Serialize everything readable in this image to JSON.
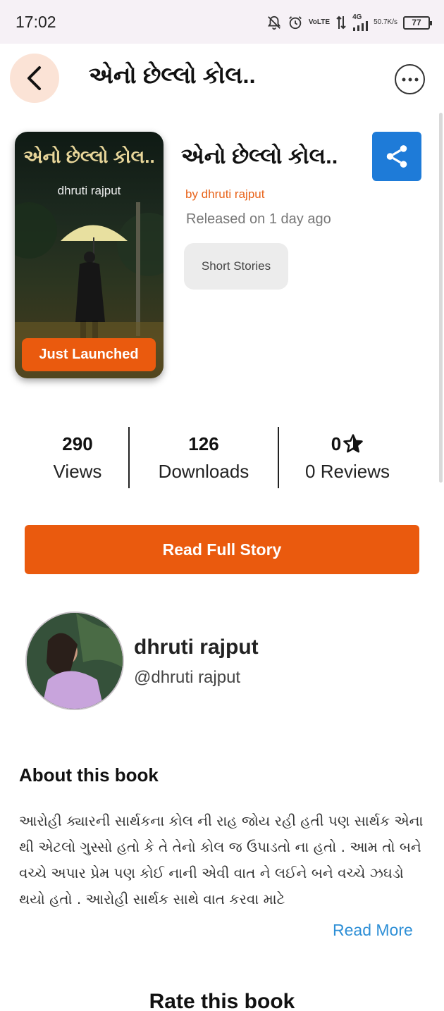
{
  "status_bar": {
    "time": "17:02",
    "volte_top": "Vo",
    "volte_bottom": "LTE",
    "network": "4G",
    "speed_top": "50.7",
    "speed_bottom": "K/s",
    "battery": "77"
  },
  "header": {
    "title": "એનો છેલ્લો કોલ.."
  },
  "book": {
    "cover_title": "એનો છેલ્લો કોલ..",
    "cover_author": "dhruti rajput",
    "badge": "Just Launched",
    "title": "એનો છેલ્લો કોલ..",
    "author_line": "by dhruti rajput",
    "released": "Released on 1 day ago",
    "genre": "Short Stories"
  },
  "stats": {
    "views_count": "290",
    "views_label": "Views",
    "downloads_count": "126",
    "downloads_label": "Downloads",
    "rating_value": "0",
    "reviews_label": "0 Reviews"
  },
  "read_button": "Read Full Story",
  "author": {
    "name": "dhruti rajput",
    "handle": "@dhruti rajput"
  },
  "about": {
    "heading": "About this book",
    "text": "આરોહી ક્યારની સાર્થકના કોલ ની રાહ જોય રહી હતી પણ સાર્થક એના થી એટલો ગુસ્સો હતો કે તે તેનો કોલ જ ઉપાડતો ના હતો . આમ તો બને વચ્ચે અપાર પ્રેમ પણ કોઈ નાની એવી વાત ને લઈને બને વચ્ચે ઝઘડો થયો હતો .  આરોહી સાર્થક સાથે વાત કરવા માટે",
    "read_more": "Read More"
  },
  "rate": {
    "heading": "Rate this book"
  },
  "colors": {
    "accent": "#ea5a0e",
    "share": "#1e7bd8",
    "link": "#2e8fd6"
  }
}
